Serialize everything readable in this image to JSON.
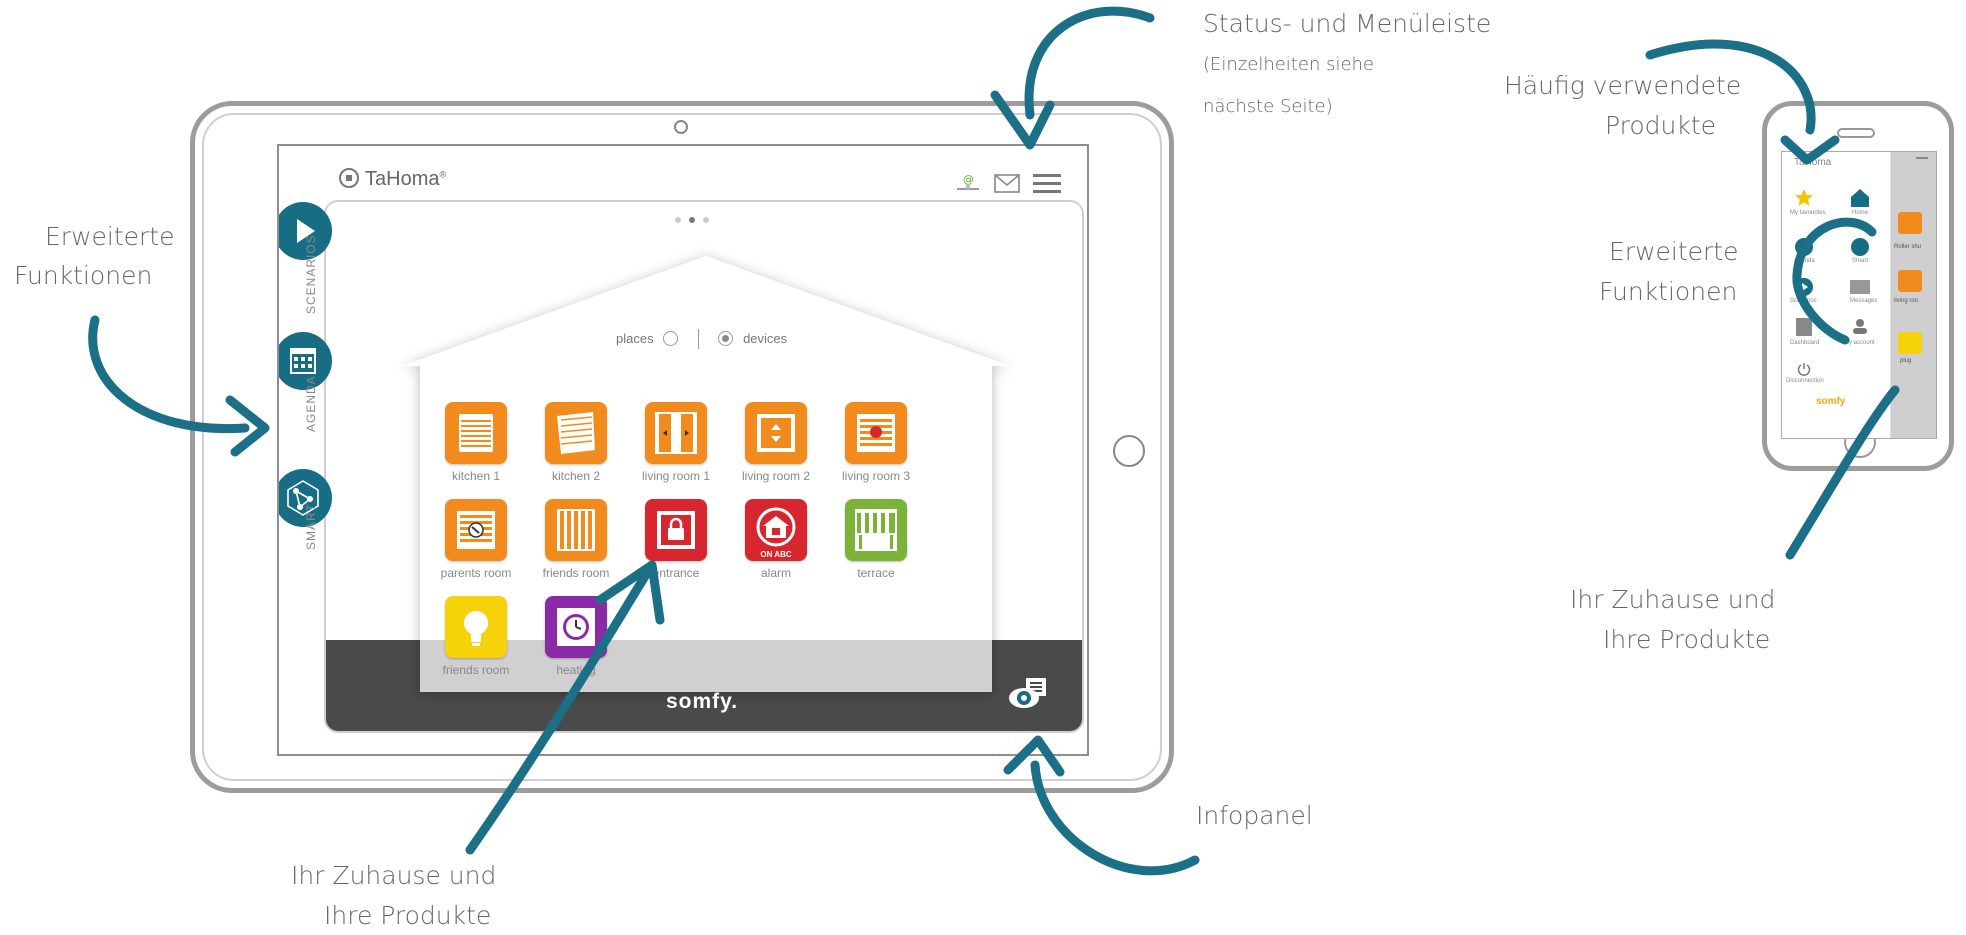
{
  "annotations": {
    "status_menu_title": "Status- und Menüleiste",
    "status_menu_detail_1": "(Einzelheiten siehe",
    "status_menu_detail_2": "nächste Seite)",
    "extended_left_1": "Erweiterte",
    "extended_left_2": "Funktionen",
    "home_products_1": "Ihr Zuhause und",
    "home_products_2": "Ihre Produkte",
    "infopanel": "Infopanel",
    "frequent_1": "Häufig verwendete",
    "frequent_2": "Produkte",
    "extended_right_1": "Erweiterte",
    "extended_right_2": "Funktionen",
    "home_products_right_1": "Ihr Zuhause und",
    "home_products_right_2": "Ihre Produkte"
  },
  "colors": {
    "arrow": "#1b6f86",
    "orange": "#f28b1d",
    "red": "#d7262d",
    "green": "#7bb33a",
    "yellow": "#f5d20a",
    "purple": "#8a2aa7",
    "teal": "#176d84",
    "bottom_bar": "#4a4a4a"
  },
  "tablet": {
    "logo": "TaHoma",
    "logo_mark": "®",
    "toggle": {
      "places": "places",
      "devices": "devices",
      "selected": "devices"
    },
    "sidebar": [
      "SCENARIOS",
      "AGENDA",
      "SMART"
    ],
    "brand": "somfy.",
    "devices": [
      {
        "label": "kitchen 1",
        "color": "#f28b1d",
        "icon": "roller-shutter-icon"
      },
      {
        "label": "kitchen 2",
        "color": "#f28b1d",
        "icon": "velux-window-icon"
      },
      {
        "label": "living room 1",
        "color": "#f28b1d",
        "icon": "curtain-icon"
      },
      {
        "label": "living room 2",
        "color": "#f28b1d",
        "icon": "window-opener-icon"
      },
      {
        "label": "living room 3",
        "color": "#f28b1d",
        "icon": "blind-icon"
      },
      {
        "label": "parents room",
        "color": "#f28b1d",
        "icon": "shutter-sensor-icon"
      },
      {
        "label": "friends room",
        "color": "#f28b1d",
        "icon": "vertical-blind-icon"
      },
      {
        "label": "entrance",
        "color": "#d7262d",
        "icon": "lock-icon"
      },
      {
        "label": "alarm",
        "color": "#d7262d",
        "icon": "alarm-icon",
        "badge": "ON ABC"
      },
      {
        "label": "terrace",
        "color": "#7bb33a",
        "icon": "awning-icon"
      },
      {
        "label": "friends room",
        "color": "#f5d20a",
        "icon": "light-bulb-icon"
      },
      {
        "label": "heating",
        "color": "#8a2aa7",
        "icon": "heating-clock-icon"
      }
    ]
  },
  "phone": {
    "logo": "TaHoma",
    "menu": [
      {
        "label": "My favourites",
        "icon": "star-icon"
      },
      {
        "label": "Home",
        "icon": "home-icon"
      },
      {
        "label": "Agenda",
        "icon": "calendar-icon"
      },
      {
        "label": "Smart",
        "icon": "smart-icon"
      },
      {
        "label": "Scenarios",
        "icon": "play-icon"
      },
      {
        "label": "Messages",
        "icon": "envelope-icon"
      },
      {
        "label": "Dashboard",
        "icon": "dashboard-icon"
      },
      {
        "label": "My account",
        "icon": "user-icon"
      },
      {
        "label": "Disconnection",
        "icon": "power-icon"
      }
    ],
    "side_labels": [
      "Roller shu",
      "living roo",
      "plug"
    ],
    "brand": "somfy"
  }
}
